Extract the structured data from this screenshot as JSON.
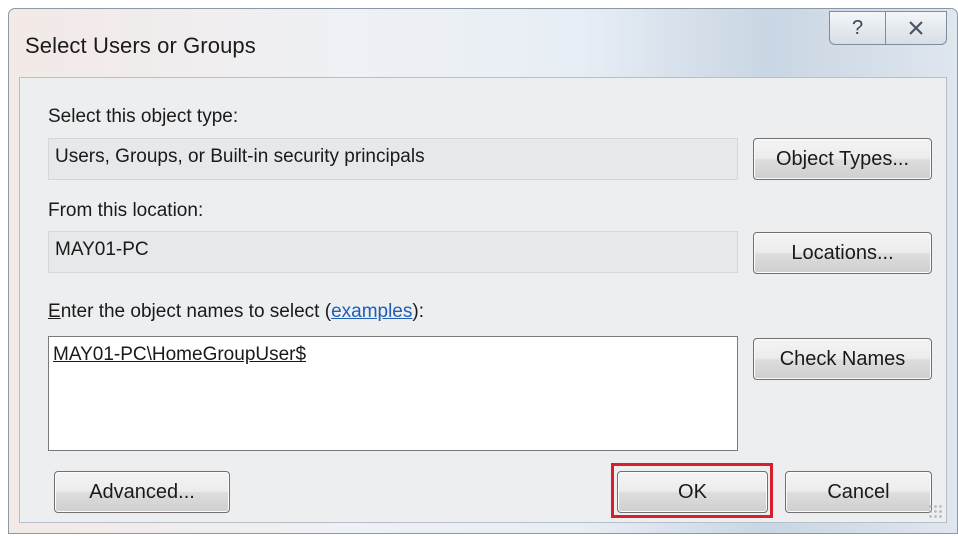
{
  "window": {
    "title": "Select Users or Groups",
    "help_glyph": "?",
    "close_icon": "close-icon"
  },
  "object_type": {
    "label": "Select this object type:",
    "value": "Users, Groups, or Built-in security principals",
    "button": "Object Types..."
  },
  "location": {
    "label": "From this location:",
    "value": "MAY01-PC",
    "button": "Locations..."
  },
  "names": {
    "label_accel": "E",
    "label_rest": "nter the object names to select (",
    "examples_link": "examples",
    "label_tail": "):",
    "value": "MAY01-PC\\HomeGroupUser$",
    "check_button": "Check Names"
  },
  "footer": {
    "advanced_button": "Advanced...",
    "ok_button": "OK",
    "cancel_button": "Cancel"
  },
  "colors": {
    "highlight": "#d8202a",
    "link": "#1f5fb3"
  }
}
